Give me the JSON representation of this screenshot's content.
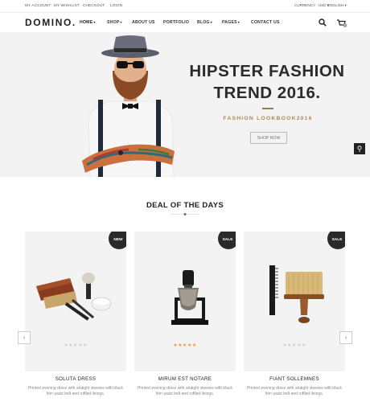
{
  "topbar": {
    "left_links": [
      "My Account",
      "My Wishlist",
      "Checkout",
      "Login"
    ],
    "currency": "CURRENCY : USD",
    "language": "ENGLISH"
  },
  "header": {
    "logo": "DOMINO.",
    "nav": [
      {
        "label": "HOME",
        "dropdown": true
      },
      {
        "label": "SHOP",
        "dropdown": true
      },
      {
        "label": "ABOUT US",
        "dropdown": false
      },
      {
        "label": "PORTFOLIO",
        "dropdown": false
      },
      {
        "label": "BLOG",
        "dropdown": true
      },
      {
        "label": "PAGES",
        "dropdown": true
      },
      {
        "label": "CONTACT US",
        "dropdown": false
      }
    ],
    "cart_count": "0"
  },
  "hero": {
    "title_line1": "HIPSTER FASHION",
    "title_line2": "TREND 2016.",
    "subtitle": "FASHION LOOKBOOK2016",
    "button": "SHOP NOW"
  },
  "deals": {
    "title": "DEAL OF THE DAYS",
    "products": [
      {
        "name": "SOLUTA DRESS",
        "badge": "NEW",
        "rating": 0,
        "desc": "Printed evening dress with straight sleeves with black thin waist belt and ruffled linings."
      },
      {
        "name": "MIRUM EST NOTARE",
        "badge": "SALE",
        "rating": 5,
        "desc": "Printed evening dress with straight sleeves with black thin waist belt and ruffled linings."
      },
      {
        "name": "FIANT SOLLEMNES",
        "badge": "SALE",
        "rating": 0,
        "desc": "Printed evening dress with straight sleeves with black thin waist belt and ruffled linings."
      }
    ]
  },
  "colors": {
    "accent": "#a98b5a",
    "dark": "#2a2a2a",
    "star_on": "#e2a33a",
    "star_off": "#cfcfcf"
  },
  "icons": [
    "search-icon",
    "cart-icon",
    "chevron-down-icon",
    "prev-arrow-icon",
    "next-arrow-icon",
    "accessibility-icon"
  ]
}
